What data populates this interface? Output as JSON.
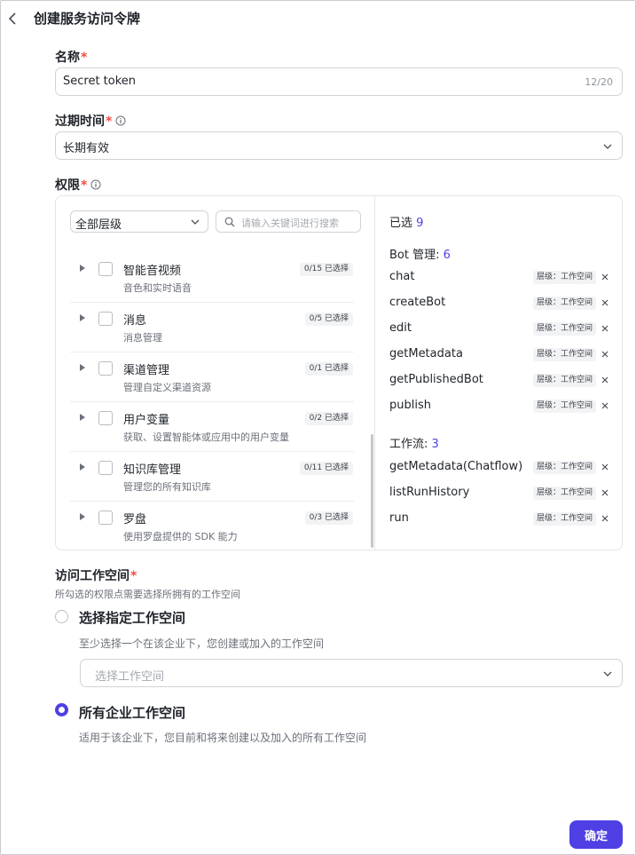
{
  "header": {
    "title": "创建服务访问令牌"
  },
  "name_field": {
    "label": "名称",
    "value": "Secret token",
    "counter": "12/20"
  },
  "expiry_field": {
    "label": "过期时间",
    "value": "长期有效"
  },
  "permissions": {
    "label": "权限",
    "level_select": "全部层级",
    "search_placeholder": "请输入关键词进行搜索",
    "items": [
      {
        "name": "智能音视频",
        "desc": "音色和实时语音",
        "selected": "0/15 已选择"
      },
      {
        "name": "消息",
        "desc": "消息管理",
        "selected": "0/5 已选择"
      },
      {
        "name": "渠道管理",
        "desc": "管理自定义渠道资源",
        "selected": "0/1 已选择"
      },
      {
        "name": "用户变量",
        "desc": "获取、设置智能体或应用中的用户变量",
        "selected": "0/2 已选择"
      },
      {
        "name": "知识库管理",
        "desc": "管理您的所有知识库",
        "selected": "0/11 已选择"
      },
      {
        "name": "罗盘",
        "desc": "使用罗盘提供的 SDK 能力",
        "selected": "0/3 已选择"
      }
    ],
    "selected_label": "已选",
    "selected_count": "9",
    "groups": [
      {
        "title": "Bot 管理:",
        "count": "6",
        "rows": [
          {
            "name": "chat",
            "tag": "层级：工作空间"
          },
          {
            "name": "createBot",
            "tag": "层级：工作空间"
          },
          {
            "name": "edit",
            "tag": "层级：工作空间"
          },
          {
            "name": "getMetadata",
            "tag": "层级：工作空间"
          },
          {
            "name": "getPublishedBot",
            "tag": "层级：工作空间"
          },
          {
            "name": "publish",
            "tag": "层级：工作空间"
          }
        ]
      },
      {
        "title": "工作流:",
        "count": "3",
        "rows": [
          {
            "name": "getMetadata(Chatflow)",
            "tag": "层级：工作空间"
          },
          {
            "name": "listRunHistory",
            "tag": "层级：工作空间"
          },
          {
            "name": "run",
            "tag": "层级：工作空间"
          }
        ]
      }
    ]
  },
  "workspace": {
    "label": "访问工作空间",
    "hint": "所勾选的权限点需要选择所拥有的工作空间",
    "option_specific": {
      "label": "选择指定工作空间",
      "desc": "至少选择一个在该企业下，您创建或加入的工作空间",
      "placeholder": "选择工作空间"
    },
    "option_all": {
      "label": "所有企业工作空间",
      "desc": "适用于该企业下，您目前和将来创建以及加入的所有工作空间"
    }
  },
  "confirm_label": "确定",
  "colors": {
    "accent": "#4e40e5",
    "required": "#f54a45"
  }
}
